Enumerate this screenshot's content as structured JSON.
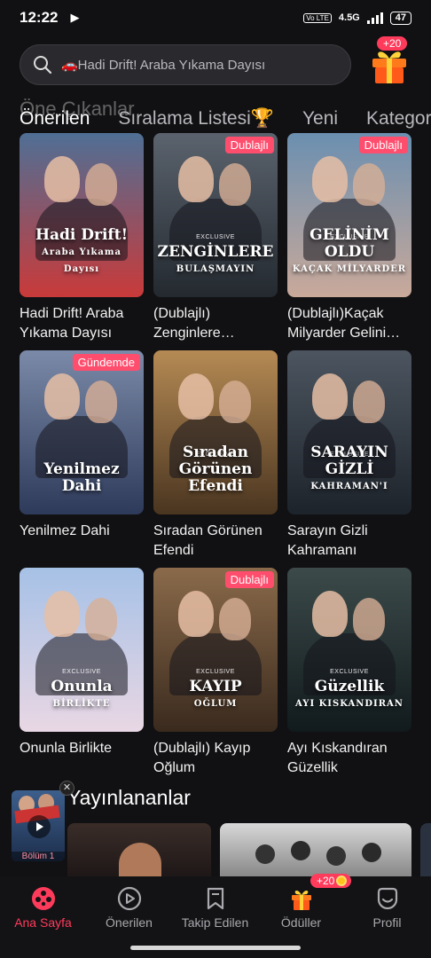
{
  "status_bar": {
    "time": "12:22",
    "network": "4.5G",
    "volte": "Vo LTE",
    "battery": "47"
  },
  "search": {
    "placeholder": "🚗Hadi Drift! Araba Yıkama Dayısı"
  },
  "rewards_badge": "+20",
  "ghost_title": "Öne Çıkanlar",
  "tabs": [
    {
      "label": "Önerilen",
      "active": true
    },
    {
      "label": "Sıralama Listesi🏆",
      "active": false
    },
    {
      "label": "Yeni",
      "active": false
    },
    {
      "label": "Kategori",
      "active": false
    }
  ],
  "dramas": [
    {
      "title": "Hadi Drift! Araba Yıkama Dayısı",
      "poster_text": "Hadi Drift!",
      "poster_sub": "Araba Yıkama Dayısı",
      "tag": "",
      "colors": [
        "#4f6f95",
        "#c93a3a"
      ]
    },
    {
      "title": "(Dublajlı) Zenginlere Bulaşmayın",
      "poster_text": "ZENGİNLERE",
      "poster_sub": "BULAŞMAYIN",
      "tag": "Dublajlı",
      "colors": [
        "#5b636e",
        "#23292f"
      ]
    },
    {
      "title": "(Dublajlı)Kaçak Milyarder Gelinim Oldu",
      "poster_text": "GELİNİM OLDU",
      "poster_sub": "KAÇAK MİLYARDER",
      "tag": "Dublajlı",
      "colors": [
        "#6b8fb0",
        "#c9a99a"
      ]
    },
    {
      "title": "Yenilmez Dahi",
      "poster_text": "Yenilmez Dahi",
      "poster_sub": "",
      "tag": "Gündemde",
      "colors": [
        "#7b8aa8",
        "#2e3a5a"
      ]
    },
    {
      "title": "Sıradan Görünen Efendi",
      "poster_text": "Sıradan Görünen Efendi",
      "poster_sub": "",
      "tag": "",
      "colors": [
        "#b58a54",
        "#4a3520"
      ]
    },
    {
      "title": "Sarayın Gizli Kahramanı",
      "poster_text": "SARAYIN GİZLİ",
      "poster_sub": "KAHRAMAN'I",
      "tag": "",
      "colors": [
        "#4c5560",
        "#1d232a"
      ]
    },
    {
      "title": "Onunla Birlikte",
      "poster_text": "Onunla",
      "poster_sub": "BİRLİKTE",
      "tag": "",
      "colors": [
        "#a6c1e6",
        "#e9d7e4"
      ]
    },
    {
      "title": "(Dublajlı)  Kayıp Oğlum",
      "poster_text": "KAYIP",
      "poster_sub": "OĞLUM",
      "tag": "Dublajlı",
      "colors": [
        "#8a6a4a",
        "#3a2a1e"
      ]
    },
    {
      "title": "Ayı Kıskandıran Güzellik",
      "poster_text": "Güzellik",
      "poster_sub": "AYI KISKANDIRAN",
      "tag": "",
      "colors": [
        "#3c4a4a",
        "#111a1c"
      ]
    }
  ],
  "exclusive_label": "EXCLUSIVE",
  "section_released": "Yayınlananlar",
  "mini_player": {
    "label": "Bölüm 1"
  },
  "bottom_nav": [
    {
      "label": "Ana Sayfa",
      "icon": "film-reel-icon",
      "active": true
    },
    {
      "label": "Önerilen",
      "icon": "play-circle-icon",
      "active": false
    },
    {
      "label": "Takip Edilen",
      "icon": "bookmark-icon",
      "active": false
    },
    {
      "label": "Ödüller",
      "icon": "gift-icon",
      "active": false
    },
    {
      "label": "Profil",
      "icon": "profile-icon",
      "active": false
    }
  ],
  "nav_badge": "+20",
  "accent_color": "#ff3b5c"
}
